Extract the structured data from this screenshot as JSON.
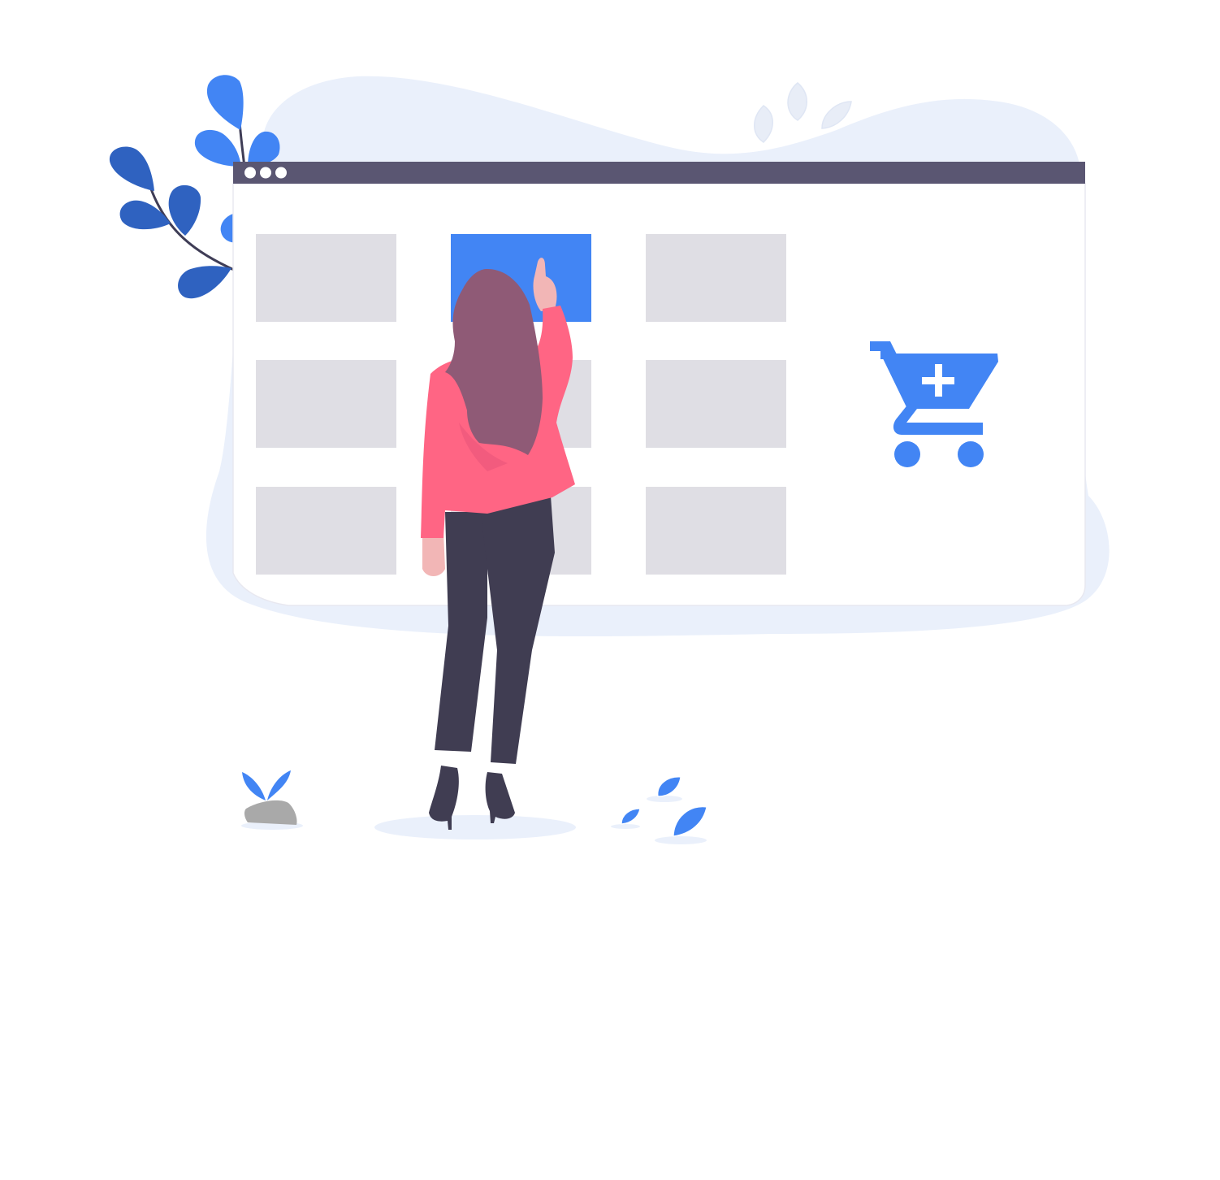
{
  "colors": {
    "background": "#ffffff",
    "blob": "#eaf0fb",
    "window_bar": "#5a5672",
    "window_body": "#ffffff",
    "window_border": "#e8e8f0",
    "tile": "#dfdee4",
    "tile_selected": "#4285f4",
    "accent": "#4285f4",
    "leaf_dark": "#2f62c0",
    "jacket": "#ff6584",
    "hair": "#8f5a76",
    "pants": "#403d52",
    "skin": "#f2b6b6",
    "rock": "#a9a9a9",
    "faint_leaf": "#e8edf7"
  },
  "window": {
    "dots": 3,
    "tiles": [
      {
        "row": 1,
        "col": 1,
        "selected": false
      },
      {
        "row": 1,
        "col": 2,
        "selected": true
      },
      {
        "row": 1,
        "col": 3,
        "selected": false
      },
      {
        "row": 2,
        "col": 1,
        "selected": false
      },
      {
        "row": 2,
        "col": 2,
        "selected": false
      },
      {
        "row": 2,
        "col": 3,
        "selected": false
      },
      {
        "row": 3,
        "col": 1,
        "selected": false
      },
      {
        "row": 3,
        "col": 2,
        "selected": false
      },
      {
        "row": 3,
        "col": 3,
        "selected": false
      }
    ]
  },
  "icons": {
    "cart": "add-to-cart-icon",
    "window_dot": "window-dot-icon"
  }
}
